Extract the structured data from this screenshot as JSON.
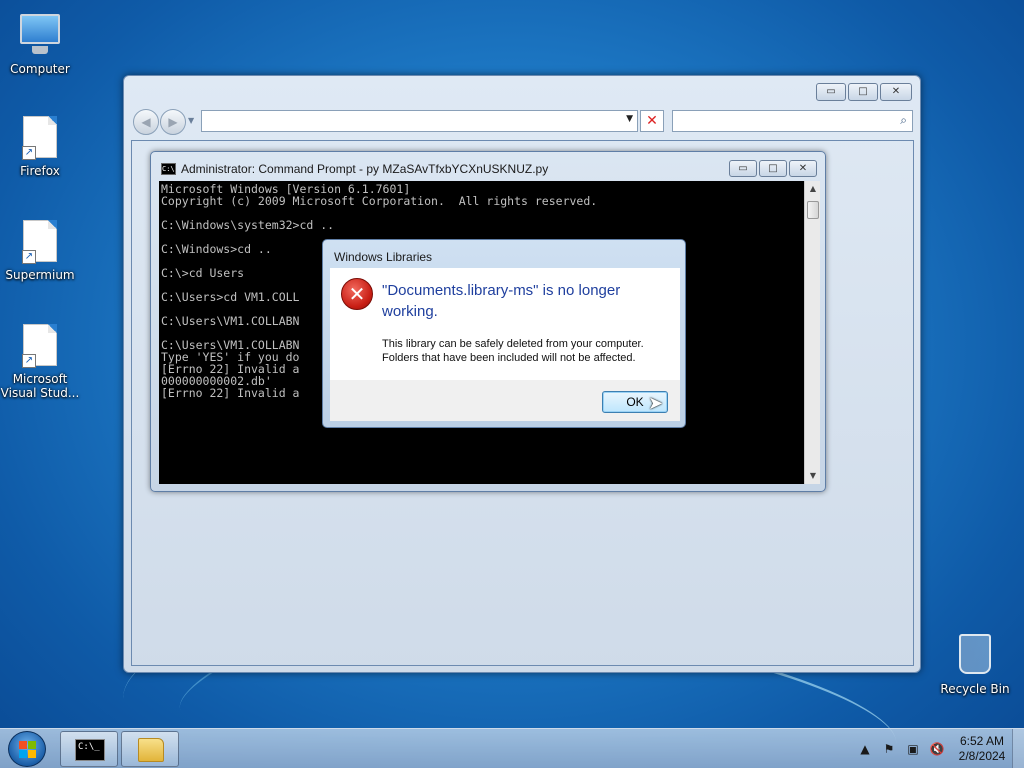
{
  "desktop": {
    "icons": [
      {
        "label": "Computer",
        "icon": "computer-icon"
      },
      {
        "label": "Firefox",
        "icon": "shortcut-file-icon"
      },
      {
        "label": "Supermium",
        "icon": "shortcut-file-icon"
      },
      {
        "label": "Microsoft Visual Stud...",
        "icon": "shortcut-file-icon"
      },
      {
        "label": "Recycle Bin",
        "icon": "recycle-bin-icon"
      }
    ]
  },
  "explorer": {
    "address_value": "",
    "search_value": "",
    "controls": {
      "minimize": "▭",
      "maximize": "□",
      "close": "✕"
    }
  },
  "cmd": {
    "title": "Administrator:  Command Prompt - py  MZaSAvTfxbYCXnUSKNUZ.py",
    "icon_text": "C:\\",
    "lines": [
      "Microsoft Windows [Version 6.1.7601]",
      "Copyright (c) 2009 Microsoft Corporation.  All rights reserved.",
      "",
      "C:\\Windows\\system32>cd ..",
      "",
      "C:\\Windows>cd ..",
      "",
      "C:\\>cd Users",
      "",
      "C:\\Users>cd VM1.COLL",
      "",
      "C:\\Users\\VM1.COLLABN",
      "",
      "C:\\Users\\VM1.COLLABN",
      "Type 'YES' if you do                                          ES",
      "[Errno 22] Invalid a                                         9}.1.ver0x0000",
      "000000000002.db'",
      "[Errno 22] Invalid a"
    ]
  },
  "dialog": {
    "title": "Windows Libraries",
    "main_message": "\"Documents.library-ms\" is no longer working.",
    "sub_message": "This library can be safely deleted from your computer. Folders that have been included will not be affected.",
    "ok_label": "OK"
  },
  "taskbar": {
    "cmd_icon_text": "C:\\_",
    "clock_time": "6:52 AM",
    "clock_date": "2/8/2024"
  }
}
